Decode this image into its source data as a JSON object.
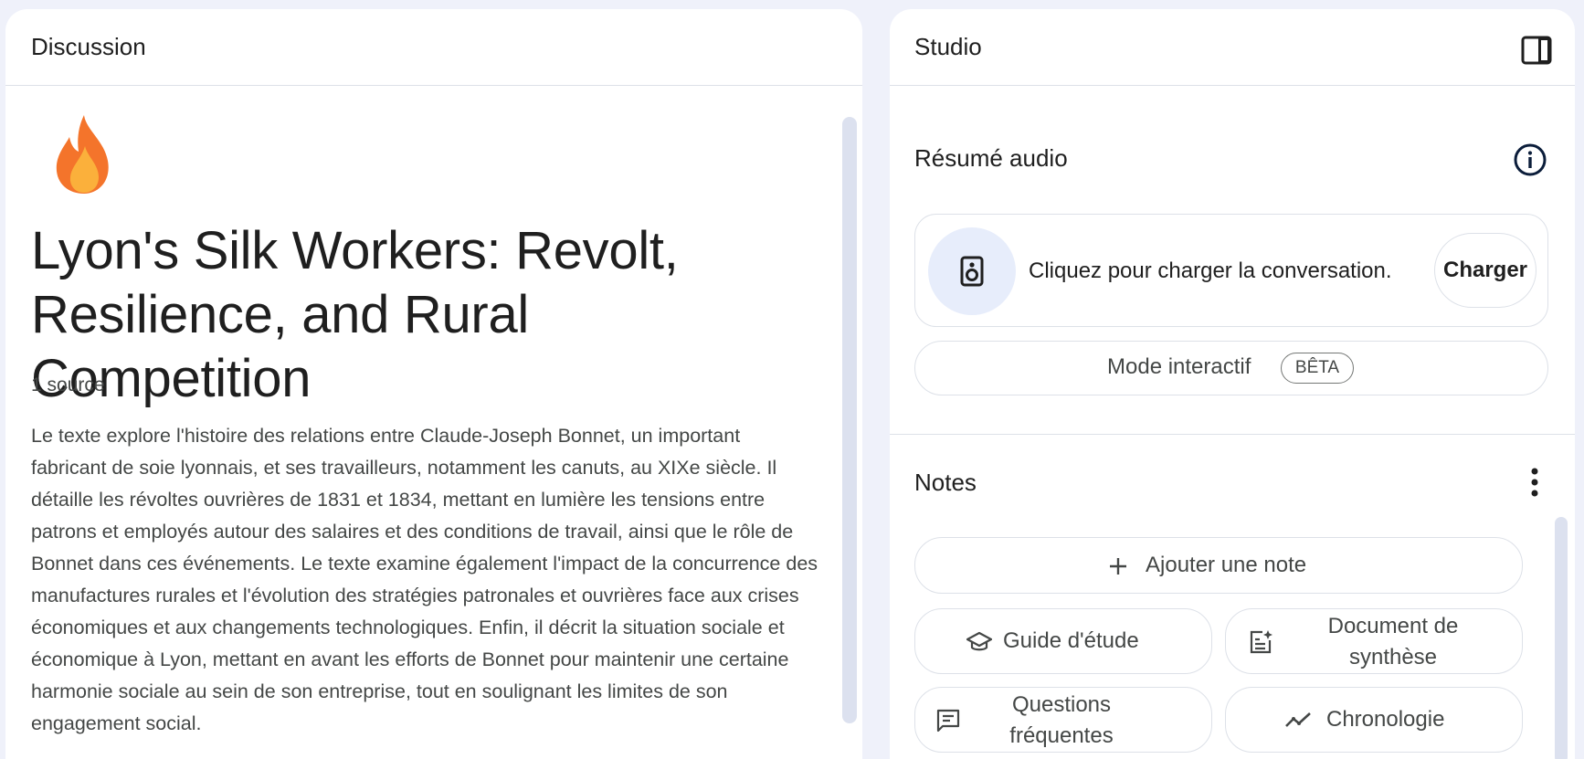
{
  "discussion": {
    "panel_title": "Discussion",
    "notebook_title": "Lyon's Silk Workers: Revolt, Resilience, and Rural Competition",
    "source_count": "1 source",
    "summary": "Le texte explore l'histoire des relations entre Claude-Joseph Bonnet, un important fabricant de soie lyonnais, et ses travailleurs, notamment les canuts, au XIXe siècle. Il détaille les révoltes ouvrières de 1831 et 1834, mettant en lumière les tensions entre patrons et employés autour des salaires et des conditions de travail, ainsi que le rôle de Bonnet dans ces événements. Le texte examine également l'impact de la concurrence des manufactures rurales et l'évolution des stratégies patronales et ouvrières face aux crises économiques et aux changements technologiques. Enfin, il décrit la situation sociale et économique à Lyon, mettant en avant les efforts de Bonnet pour maintenir une certaine harmonie sociale au sein de son entreprise, tout en soulignant les limites de son engagement social.",
    "emoji_icon": "fire-icon"
  },
  "studio": {
    "panel_title": "Studio",
    "audio": {
      "title": "Résumé audio",
      "prompt": "Cliquez pour charger la conversation.",
      "load_label": "Charger",
      "interactive_label": "Mode interactif",
      "beta_label": "BÊTA"
    },
    "notes": {
      "title": "Notes",
      "add_note_label": "Ajouter une note",
      "study_guide_label": "Guide d'étude",
      "briefing_doc_label": "Document de synthèse",
      "faq_label": "Questions fréquentes",
      "timeline_label": "Chronologie"
    }
  },
  "colors": {
    "background": "#eff1fa",
    "panel": "#ffffff",
    "accent_circle": "#e7edfb",
    "text_primary": "#1f1f1f",
    "text_secondary": "#444746",
    "border": "#dde1e8"
  }
}
